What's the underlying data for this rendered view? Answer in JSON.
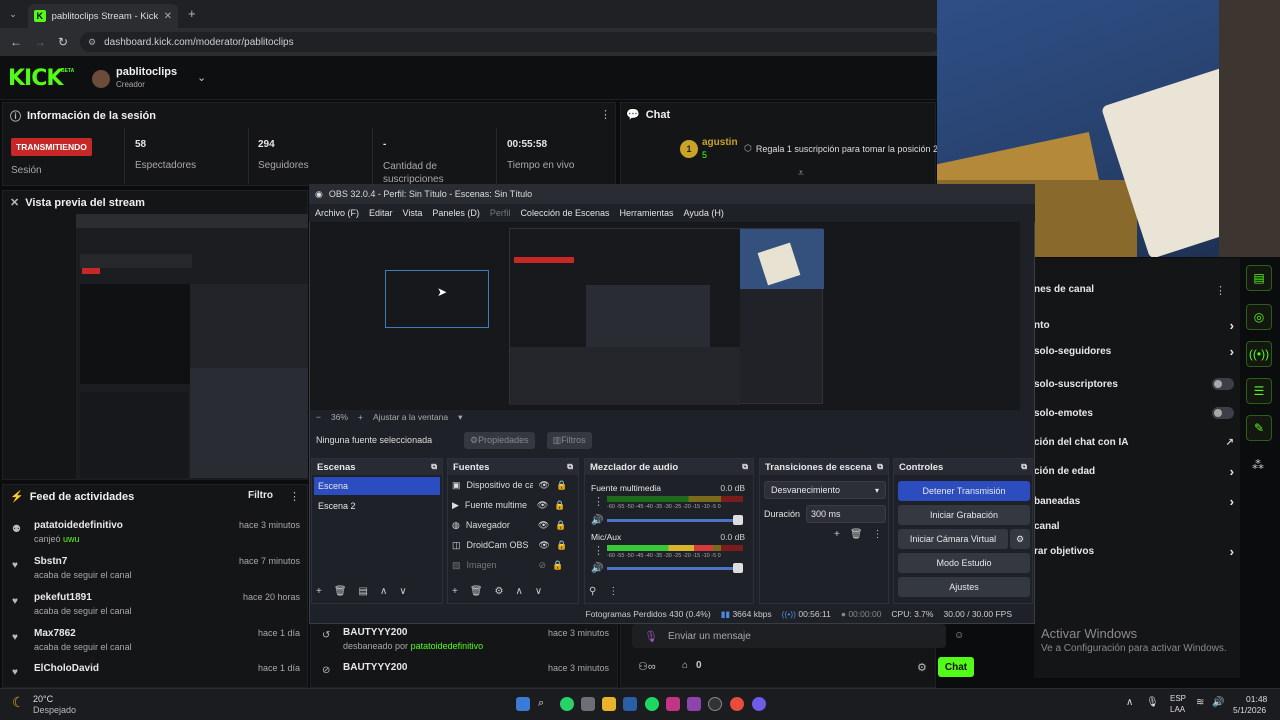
{
  "browser": {
    "tab_title": "pablitoclips Stream - Kick Dashb",
    "url": "dashboard.kick.com/moderator/pablitoclips"
  },
  "kick": {
    "logo": "KICK",
    "beta": "BETA",
    "channel_name": "pablitoclips",
    "channel_role": "Creador"
  },
  "session": {
    "title": "Información de la sesión",
    "live_badge": "TRANSMITIENDO",
    "session_label": "Sesión",
    "stats": [
      {
        "value": "58",
        "label": "Espectadores"
      },
      {
        "value": "294",
        "label": "Seguidores"
      },
      {
        "value": "-",
        "label": "Cantidad de suscripciones"
      },
      {
        "value": "00:55:58",
        "label": "Tiempo en vivo"
      }
    ]
  },
  "preview": {
    "title": "Vista previa del stream"
  },
  "chat": {
    "title": "Chat",
    "top_user": "agustin",
    "top_user_rank": "1",
    "top_user_count": "5",
    "promo": "Regala 1 suscripción para tomar la posición 2",
    "input_placeholder": "Enviar un mensaje",
    "viewer_count": "0",
    "send_button": "Chat"
  },
  "obs": {
    "window_title": "OBS 32.0.4 - Perfil: Sin Título - Escenas: Sin Título",
    "menu": [
      "Archivo (F)",
      "Editar",
      "Vista",
      "Paneles (D)",
      "Perfil",
      "Colección de Escenas",
      "Herramientas",
      "Ayuda (H)"
    ],
    "zoom": "36%",
    "fit": "Ajustar a la ventana",
    "no_source": "Ninguna fuente seleccionada",
    "properties": "Propiedades",
    "filters": "Filtros",
    "scenes_title": "Escenas",
    "scenes": [
      "Escena",
      "Escena 2"
    ],
    "sources_title": "Fuentes",
    "sources": [
      "Dispositivo de ca",
      "Fuente multime",
      "Navegador",
      "DroidCam OBS",
      "Imagen"
    ],
    "mixer_title": "Mezclador de audio",
    "mixer": [
      {
        "name": "Fuente multimedia",
        "db": "0.0 dB",
        "level": 0.0
      },
      {
        "name": "Mic/Aux",
        "db": "0.0 dB",
        "level": 0.78
      }
    ],
    "meter_scale": "-60 -55 -50 -45 -40 -35 -30 -25 -20 -15 -10 -5 0",
    "transitions_title": "Transiciones de escena",
    "transition": "Desvanecimiento",
    "duration_label": "Duración",
    "duration": "300 ms",
    "controls_title": "Controles",
    "controls": [
      "Detener Transmisión",
      "Iniciar Grabación",
      "Iniciar Cámara Virtual",
      "Modo Estudio",
      "Ajustes"
    ],
    "status": {
      "dropped": "Fotogramas Perdidos 430 (0.4%)",
      "bitrate": "3664 kbps",
      "live_time": "00:56:11",
      "rec_time": "00:00:00",
      "cpu": "CPU: 3.7%",
      "fps": "30.00 / 30.00 FPS"
    }
  },
  "activity": {
    "title": "Feed de actividades",
    "filter": "Filtro",
    "items": [
      {
        "name": "patatoidedefinitivo",
        "text": "canjeó",
        "highlight": "uwu",
        "time": "hace 3 minutos"
      },
      {
        "name": "Sbstn7",
        "text": "acaba de seguir el canal",
        "highlight": "",
        "time": "hace 7 minutos"
      },
      {
        "name": "pekefut1891",
        "text": "acaba de seguir el canal",
        "highlight": "",
        "time": "hace 20 horas"
      },
      {
        "name": "Max7862",
        "text": "acaba de seguir el canal",
        "highlight": "",
        "time": "hace 1 día"
      },
      {
        "name": "ElCholoDavid",
        "text": "",
        "highlight": "",
        "time": "hace 1 día"
      }
    ]
  },
  "modlog": [
    {
      "name": "BAUTYYY200",
      "text": "desbaneado por",
      "by": "patatoidedefinitivo",
      "time": "hace 3 minutos"
    },
    {
      "name": "BAUTYYY200",
      "text": "",
      "by": "",
      "time": "hace 3 minutos"
    }
  ],
  "settings": {
    "section_title": "nes de canal",
    "rows": [
      "nto",
      "solo-seguidores",
      "solo-suscriptores",
      "solo-emotes",
      "ción del chat con IA",
      "ción de edad",
      "baneadas",
      "canal",
      "rar objetivos"
    ]
  },
  "watermark": {
    "title": "Activar Windows",
    "sub": "Ve a Configuración para activar Windows."
  },
  "taskbar": {
    "temp": "20°C",
    "weather": "Despejado",
    "lang1": "ESP",
    "lang2": "LAA",
    "time": "01:48",
    "date": "5/1/2026"
  }
}
